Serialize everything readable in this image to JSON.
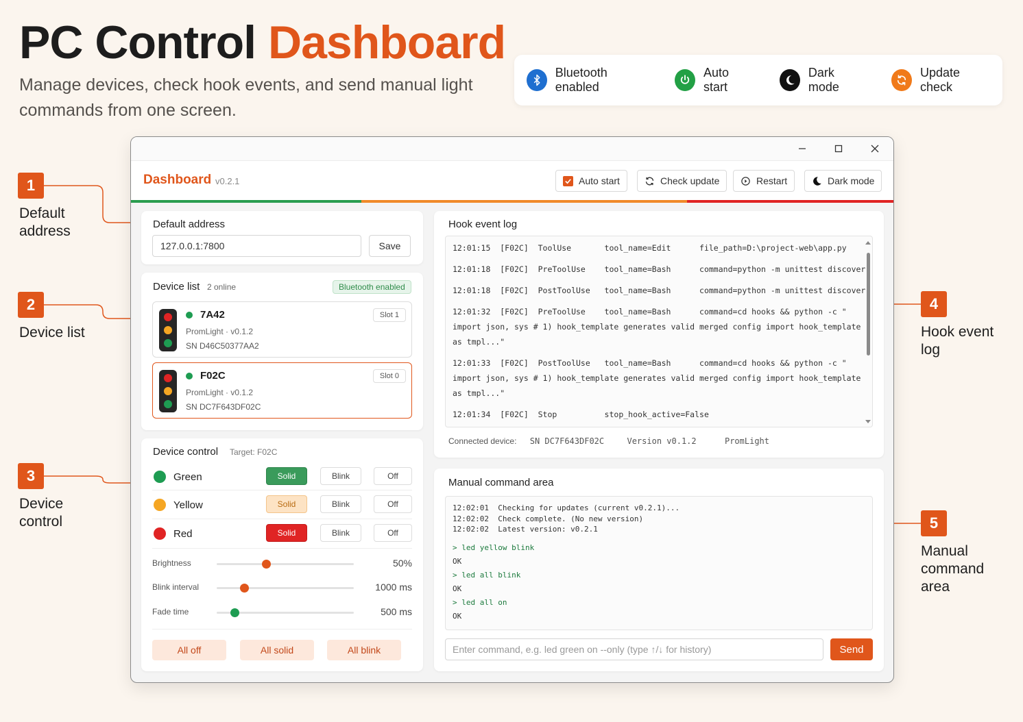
{
  "page": {
    "title_main": "PC Control",
    "title_accent": "Dashboard",
    "subtitle": "Manage devices, check hook events, and send manual light commands from one screen."
  },
  "features": [
    {
      "label": "Bluetooth enabled",
      "icon": "bluetooth-icon",
      "color": "#1f6fd0"
    },
    {
      "label": "Auto start",
      "icon": "power-icon",
      "color": "#22a045"
    },
    {
      "label": "Dark mode",
      "icon": "moon-icon",
      "color": "#111111"
    },
    {
      "label": "Update check",
      "icon": "refresh-icon",
      "color": "#f07a1a"
    }
  ],
  "callouts": [
    {
      "number": "1",
      "label": "Default address"
    },
    {
      "number": "2",
      "label": "Device list"
    },
    {
      "number": "3",
      "label": "Device control"
    },
    {
      "number": "4",
      "label": "Hook event log"
    },
    {
      "number": "5",
      "label": "Manual command area"
    }
  ],
  "app": {
    "name": "Dashboard",
    "version": "v0.2.1",
    "buttons": {
      "auto_start": "Auto start",
      "check_update": "Check update",
      "restart": "Restart",
      "dark_mode": "Dark mode"
    },
    "accent": "#e0561b"
  },
  "default_address": {
    "title": "Default address",
    "value": "127.0.0.1:7800",
    "save_label": "Save"
  },
  "device_list": {
    "title": "Device list",
    "online_count": "2 online",
    "bluetooth_badge": "Bluetooth enabled",
    "devices": [
      {
        "name": "7A42",
        "model": "PromLight · v0.1.2",
        "sn": "SN D46C50377AA2",
        "slot": "Slot 1"
      },
      {
        "name": "F02C",
        "model": "PromLight · v0.1.2",
        "sn": "SN DC7F643DF02C",
        "slot": "Slot 0"
      }
    ]
  },
  "device_control": {
    "title": "Device control",
    "target": "Target:  F02C",
    "rows": [
      {
        "name": "Green",
        "color": "#1e9c52",
        "solid": "Solid",
        "blink": "Blink",
        "off": "Off"
      },
      {
        "name": "Yellow",
        "color": "#f5a623",
        "solid": "Solid",
        "blink": "Blink",
        "off": "Off"
      },
      {
        "name": "Red",
        "color": "#e02424",
        "solid": "Solid",
        "blink": "Blink",
        "off": "Off"
      }
    ],
    "sliders": [
      {
        "label": "Brightness",
        "value": "50%",
        "fraction": 0.36,
        "color": "#e0561b"
      },
      {
        "label": "Blink interval",
        "value": "1000 ms",
        "fraction": 0.2,
        "color": "#e0561b"
      },
      {
        "label": "Fade time",
        "value": "500 ms",
        "fraction": 0.13,
        "color": "#1e9c52"
      }
    ],
    "bulk": {
      "all_off": "All off",
      "all_solid": "All solid",
      "all_blink": "All blink"
    }
  },
  "hook_log": {
    "title": "Hook event log",
    "lines": [
      "12:01:15  [F02C]  ToolUse       tool_name=Edit      file_path=D:\\project-web\\app.py",
      "12:01:18  [F02C]  PreToolUse    tool_name=Bash      command=python -m unittest discover",
      "12:01:18  [F02C]  PostToolUse   tool_name=Bash      command=python -m unittest discover",
      "12:01:32  [F02C]  PreToolUse    tool_name=Bash      command=cd hooks && python -c \"",
      "import json, sys # 1) hook_template generates valid merged config import hook_template",
      "as tmpl...\"",
      "12:01:33  [F02C]  PostToolUse   tool_name=Bash      command=cd hooks && python -c \"",
      "import json, sys # 1) hook_template generates valid merged config import hook_template",
      "as tmpl...\"",
      "12:01:34  [F02C]  Stop          stop_hook_active=False"
    ],
    "status": {
      "label": "Connected device:",
      "sn": "SN DC7F643DF02C",
      "version": "Version v0.1.2",
      "model": "PromLight"
    }
  },
  "manual": {
    "title": "Manual command area",
    "lines": [
      {
        "text": "12:02:01  Checking for updates (current v0.2.1)...",
        "kind": "normal"
      },
      {
        "text": "12:02:02  Check complete. (No new version)",
        "kind": "normal"
      },
      {
        "text": "12:02:02  Latest version: v0.2.1",
        "kind": "normal"
      },
      {
        "text": "> led yellow blink",
        "kind": "green"
      },
      {
        "text": "OK",
        "kind": "normal"
      },
      {
        "text": "> led all blink",
        "kind": "green"
      },
      {
        "text": "OK",
        "kind": "normal"
      },
      {
        "text": "> led all on",
        "kind": "green"
      },
      {
        "text": "OK",
        "kind": "normal"
      }
    ],
    "placeholder": "Enter command, e.g. led green on --only (type ↑/↓ for history)",
    "send_label": "Send"
  }
}
